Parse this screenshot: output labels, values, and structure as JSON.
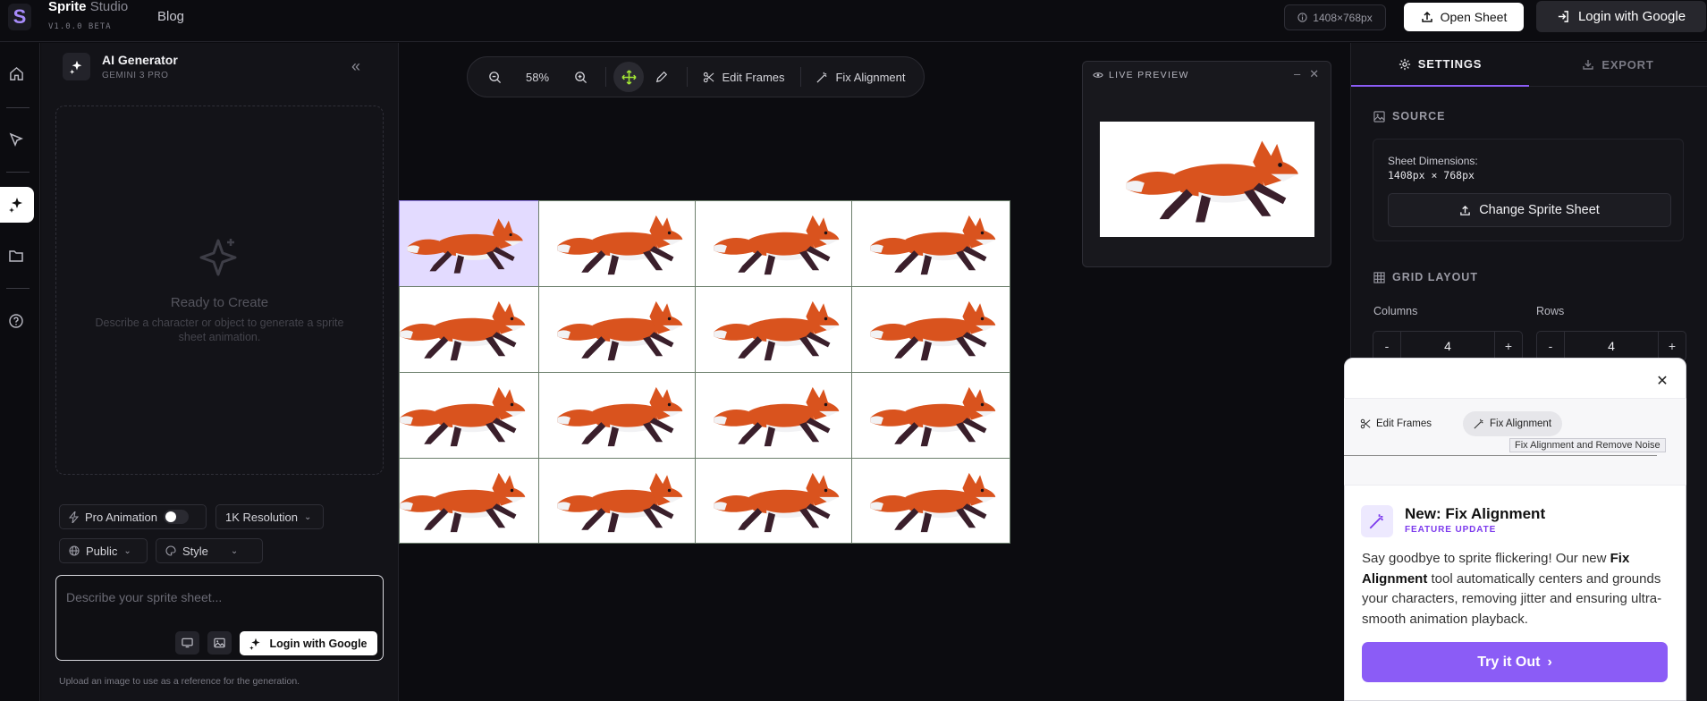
{
  "app": {
    "brand_bold": "Sprite",
    "brand_light": "Studio",
    "version": "V1.0.0 BETA",
    "nav_blog": "Blog"
  },
  "header": {
    "dims": "1408×768px",
    "open_sheet": "Open Sheet",
    "login": "Login with Google"
  },
  "rail": {
    "icons": [
      "home-icon",
      "cursor-icon",
      "sparkles-icon",
      "folder-icon",
      "help-icon"
    ],
    "active": "sparkles-icon"
  },
  "generator": {
    "title": "AI Generator",
    "subtitle": "GEMINI 3 PRO",
    "empty_title": "Ready to Create",
    "empty_desc": "Describe a character or object to generate a sprite sheet animation.",
    "pro_animation": "Pro Animation",
    "pro_animation_on": false,
    "resolution": "1K Resolution",
    "visibility": "Public",
    "style": "Style",
    "prompt_placeholder": "Describe your sprite sheet...",
    "login": "Login with Google",
    "upload_hint": "Upload an image to use as a reference for the generation."
  },
  "toolbar": {
    "zoom": "58%",
    "edit_frames": "Edit Frames",
    "fix_alignment": "Fix Alignment"
  },
  "preview": {
    "title": "LIVE PREVIEW"
  },
  "settings": {
    "tab_settings": "SETTINGS",
    "tab_export": "EXPORT",
    "source_title": "SOURCE",
    "dims_label": "Sheet Dimensions:",
    "dims_value": "1408px × 768px",
    "change_sheet": "Change Sprite Sheet",
    "grid_title": "GRID LAYOUT",
    "columns_label": "Columns",
    "columns_value": "4",
    "rows_label": "Rows",
    "rows_value": "4"
  },
  "popup": {
    "edit_frames": "Edit Frames",
    "fix_alignment": "Fix Alignment",
    "tooltip": "Fix Alignment and Remove Noise",
    "title": "New: Fix Alignment",
    "subtitle": "FEATURE UPDATE",
    "desc_1": "Say goodbye to sprite flickering! Our new ",
    "desc_bold": "Fix Alignment",
    "desc_2": " tool automatically centers and grounds your characters, removing jitter and ensuring ultra-smooth animation playback.",
    "cta": "Try it Out"
  },
  "colors": {
    "accent": "#8b5cf6",
    "fox_orange": "#d9531e",
    "fox_dark": "#3a1f2b",
    "selected_cell": "#e3dbff"
  }
}
